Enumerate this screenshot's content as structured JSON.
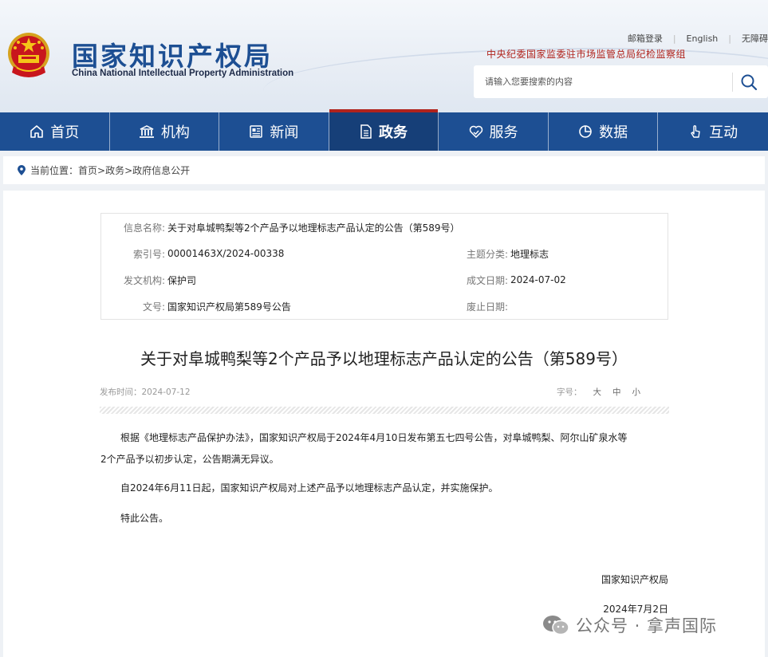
{
  "header": {
    "logo_cn": "国家知识产权局",
    "logo_en": "China National Intellectual Property Administration",
    "toplinks": [
      "邮箱登录",
      "English",
      "无障碍"
    ],
    "discipline_text": "中央纪委国家监委驻市场监管总局纪检监察组",
    "search_placeholder": "请输入您要搜索的内容"
  },
  "nav": {
    "items": [
      {
        "label": "首页",
        "icon": "home-icon"
      },
      {
        "label": "机构",
        "icon": "institution-icon"
      },
      {
        "label": "新闻",
        "icon": "news-icon"
      },
      {
        "label": "政务",
        "icon": "document-icon"
      },
      {
        "label": "服务",
        "icon": "heart-hand-icon"
      },
      {
        "label": "数据",
        "icon": "pie-chart-icon"
      },
      {
        "label": "互动",
        "icon": "hand-pointer-icon"
      }
    ],
    "active_index": 3
  },
  "breadcrumb": {
    "prefix": "当前位置：",
    "items": [
      "首页",
      "政务",
      "政府信息公开"
    ],
    "sep": ">"
  },
  "info": {
    "name_label": "信息名称:",
    "name_value": "关于对阜城鸭梨等2个产品予以地理标志产品认定的公告（第589号）",
    "index_label": "索引号:",
    "index_value": "00001463X/2024-00338",
    "topic_label": "主题分类:",
    "topic_value": "地理标志",
    "org_label": "发文机构:",
    "org_value": "保护司",
    "date_label": "成文日期:",
    "date_value": "2024-07-02",
    "docno_label": "文号:",
    "docno_value": "国家知识产权局第589号公告",
    "expire_label": "废止日期:",
    "expire_value": ""
  },
  "article": {
    "title": "关于对阜城鸭梨等2个产品予以地理标志产品认定的公告（第589号）",
    "publish_time": "发布时间：2024-07-12",
    "font_size_label": "字号：",
    "font_sizes": [
      "大",
      "中",
      "小"
    ],
    "p1_line1": "根据《地理标志产品保护办法》，国家知识产权局于2024年4月10日发布第五七四号公告，对阜城鸭梨、阿尔山矿泉水等",
    "p1_line2": "2个产品予以初步认定，公告期满无异议。",
    "p2": "自2024年6月11日起，国家知识产权局对上述产品予以地理标志产品认定，并实施保护。",
    "p3": "特此公告。",
    "sign_org": "国家知识产权局",
    "sign_date": "2024年7月2日"
  },
  "watermark": "公众号 · 拿声国际",
  "colors": {
    "brand_blue": "#1d4f93",
    "active_nav": "#163f78",
    "accent_red": "#b0231c"
  }
}
